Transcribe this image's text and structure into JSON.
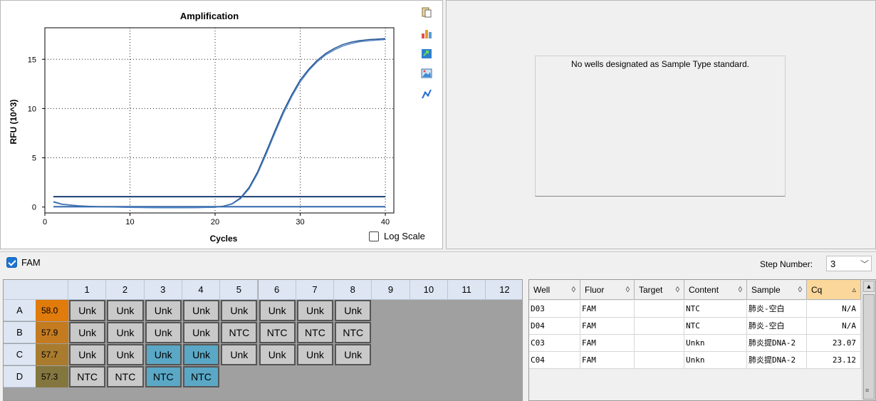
{
  "chart_data": {
    "type": "line",
    "title": "Amplification",
    "xlabel": "Cycles",
    "ylabel": "RFU (10^3)",
    "xlim": [
      0,
      41
    ],
    "ylim": [
      -0.6,
      18.2
    ],
    "xticks": [
      0,
      10,
      20,
      30,
      40
    ],
    "yticks": [
      0,
      5,
      10,
      15
    ],
    "grid": true,
    "threshold": 1.05,
    "series": [
      {
        "color": "#1f4e8c",
        "x": [
          1,
          2,
          4,
          6,
          8,
          10,
          12,
          14,
          16,
          18,
          20,
          21,
          22,
          23,
          24,
          25,
          26,
          27,
          28,
          29,
          30,
          31,
          32,
          33,
          34,
          35,
          36,
          37,
          38,
          39,
          40
        ],
        "y": [
          0.55,
          0.3,
          0.12,
          0.04,
          0.0,
          -0.03,
          -0.05,
          -0.06,
          -0.06,
          -0.05,
          -0.02,
          0.1,
          0.35,
          0.95,
          2.0,
          3.6,
          5.6,
          7.7,
          9.7,
          11.4,
          12.9,
          14.0,
          14.9,
          15.6,
          16.1,
          16.5,
          16.75,
          16.9,
          17.0,
          17.05,
          17.1
        ]
      },
      {
        "color": "#4a7fc0",
        "x": [
          1,
          2,
          4,
          6,
          8,
          10,
          12,
          14,
          16,
          18,
          20,
          21,
          22,
          23,
          24,
          25,
          26,
          27,
          28,
          29,
          30,
          31,
          32,
          33,
          34,
          35,
          36,
          37,
          38,
          39,
          40
        ],
        "y": [
          0.5,
          0.27,
          0.1,
          0.03,
          -0.01,
          -0.04,
          -0.06,
          -0.07,
          -0.07,
          -0.06,
          -0.03,
          0.08,
          0.3,
          0.85,
          1.85,
          3.4,
          5.35,
          7.45,
          9.45,
          11.2,
          12.7,
          13.85,
          14.75,
          15.45,
          15.95,
          16.35,
          16.6,
          16.78,
          16.88,
          16.95,
          17.0
        ]
      },
      {
        "color": "#1f4e8c",
        "x": [
          1,
          40
        ],
        "y": [
          0.05,
          0.05
        ]
      },
      {
        "color": "#4a7fc0",
        "x": [
          1,
          40
        ],
        "y": [
          0.0,
          0.0
        ]
      }
    ]
  },
  "chart_panel": {
    "log_scale_label": "Log Scale"
  },
  "toolbar": {
    "icons": [
      "copy-icon",
      "bar-chart-icon",
      "export-icon",
      "image-icon",
      "line-style-icon"
    ]
  },
  "standard_panel": {
    "message": "No wells designated as Sample Type standard."
  },
  "fluor_bar": {
    "fluor_label": "FAM",
    "step_label": "Step Number:",
    "step_value": "3"
  },
  "plate": {
    "columns": [
      "1",
      "2",
      "3",
      "4",
      "5",
      "6",
      "7",
      "8",
      "9",
      "10",
      "11",
      "12"
    ],
    "rows": [
      {
        "label": "A",
        "tm": "58.0",
        "tm_color": "#e07b0c",
        "wells": [
          "Unk",
          "Unk",
          "Unk",
          "Unk",
          "Unk",
          "Unk",
          "Unk",
          "Unk"
        ]
      },
      {
        "label": "B",
        "tm": "57.9",
        "tm_color": "#c47b1f",
        "wells": [
          "Unk",
          "Unk",
          "Unk",
          "Unk",
          "NTC",
          "NTC",
          "NTC",
          "NTC"
        ]
      },
      {
        "label": "C",
        "tm": "57.7",
        "tm_color": "#a97b2f",
        "wells": [
          "Unk",
          "Unk",
          "Unk",
          "Unk",
          "Unk",
          "Unk",
          "Unk",
          "Unk"
        ]
      },
      {
        "label": "D",
        "tm": "57.3",
        "tm_color": "#84763f",
        "wells": [
          "NTC",
          "NTC",
          "NTC",
          "NTC"
        ]
      }
    ],
    "selected": [
      "C3",
      "C4",
      "D3",
      "D4"
    ]
  },
  "results_table": {
    "headers": [
      {
        "label": "Well",
        "sort": "◊"
      },
      {
        "label": "Fluor",
        "sort": "◊"
      },
      {
        "label": "Target",
        "sort": "◊"
      },
      {
        "label": "Content",
        "sort": "◊"
      },
      {
        "label": "Sample",
        "sort": "◊"
      },
      {
        "label": "Cq",
        "sort": "▵"
      }
    ],
    "rows": [
      [
        "D03",
        "FAM",
        "",
        "NTC",
        "肺炎-空白",
        "N/A"
      ],
      [
        "D04",
        "FAM",
        "",
        "NTC",
        "肺炎-空白",
        "N/A"
      ],
      [
        "C03",
        "FAM",
        "",
        "Unkn",
        "肺炎提DNA-2",
        "23.07"
      ],
      [
        "C04",
        "FAM",
        "",
        "Unkn",
        "肺炎提DNA-2",
        "23.12"
      ]
    ]
  }
}
